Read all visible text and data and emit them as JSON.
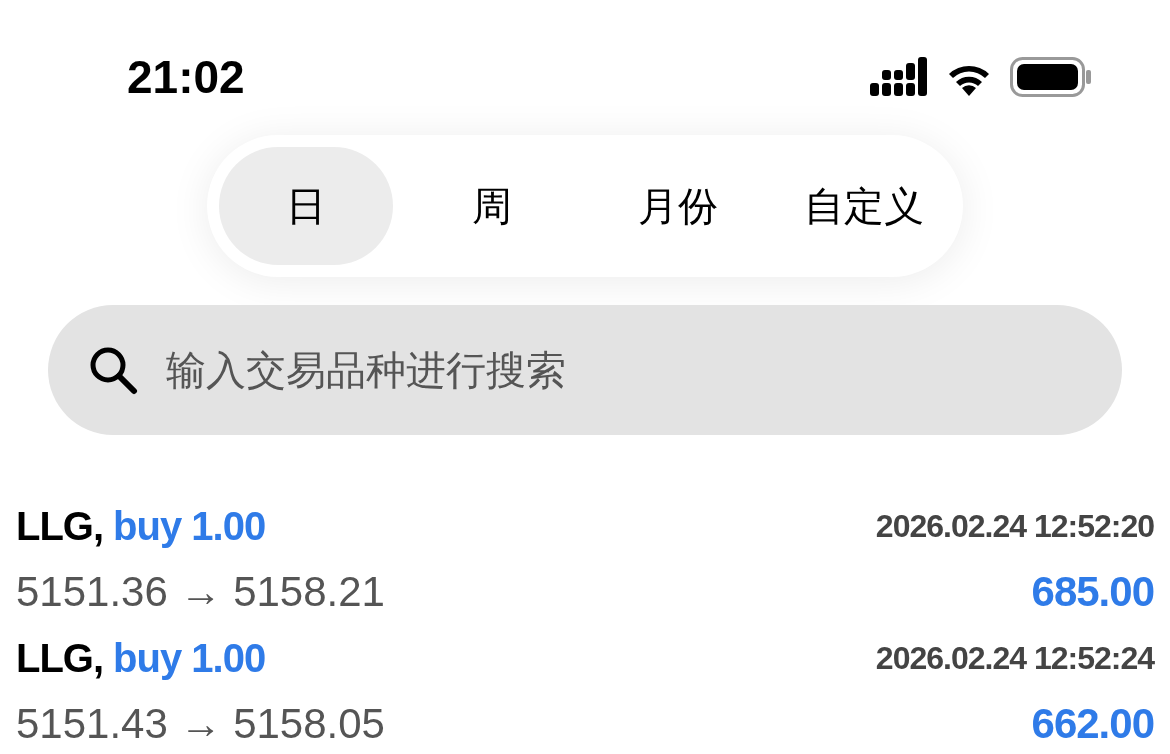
{
  "status_bar": {
    "time": "21:02"
  },
  "period_tabs": [
    {
      "label": "日",
      "selected": true
    },
    {
      "label": "周",
      "selected": false
    },
    {
      "label": "月份",
      "selected": false
    },
    {
      "label": "自定义",
      "selected": false
    }
  ],
  "search": {
    "placeholder": "输入交易品种进行搜索"
  },
  "trades": [
    {
      "symbol": "LLG,",
      "side": "buy 1.00",
      "time": "2026.02.24 12:52:20",
      "prices": "5151.36 → 5158.21",
      "profit": "685.00"
    },
    {
      "symbol": "LLG,",
      "side": "buy 1.00",
      "time": "2026.02.24 12:52:24",
      "prices": "5151.43 → 5158.05",
      "profit": "662.00"
    }
  ]
}
